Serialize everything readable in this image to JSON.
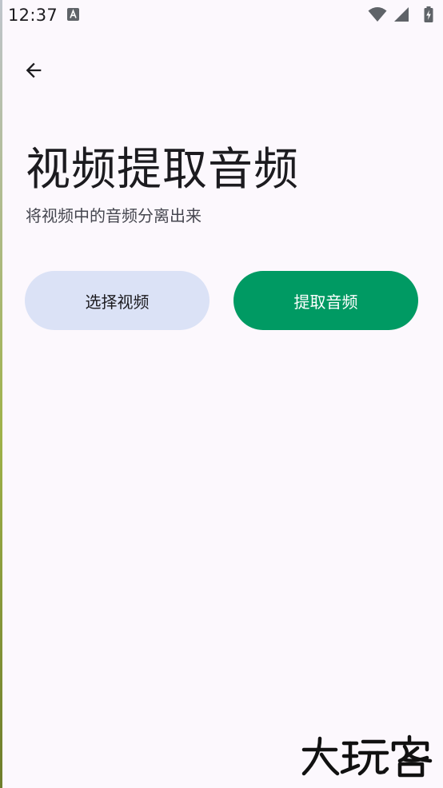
{
  "status_bar": {
    "time": "12:37"
  },
  "header": {
    "back_icon": "arrow-back-icon"
  },
  "main": {
    "title": "视频提取音频",
    "subtitle": "将视频中的音频分离出来",
    "select_video_label": "选择视频",
    "extract_audio_label": "提取音频"
  },
  "watermark": {
    "text": "大玩客"
  },
  "colors": {
    "background": "#fcf8fd",
    "primary_green": "#009a63",
    "secondary_container": "#dbe2f6",
    "text_primary": "#1c1b1f",
    "text_secondary": "#45464f"
  }
}
